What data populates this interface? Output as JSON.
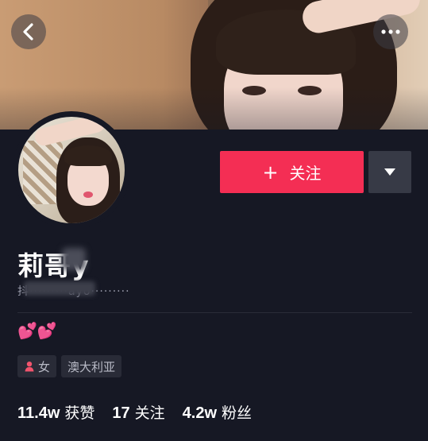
{
  "header": {
    "back_icon": "chevron-left-icon",
    "more_icon": "more-horizontal-icon"
  },
  "actions": {
    "follow_label": "关注",
    "follow_icon": "plus-icon",
    "dropdown_icon": "caret-down-icon",
    "follow_color": "#f42e54"
  },
  "profile": {
    "username": "莉哥y",
    "handle": "抖·········ayo·········",
    "bio_emoji": "💕💕",
    "tags": [
      {
        "icon": "female-icon",
        "label": "女"
      },
      {
        "icon": "",
        "label": "澳大利亚"
      }
    ]
  },
  "stats": [
    {
      "value": "11.4w",
      "label": "获赞"
    },
    {
      "value": "17",
      "label": "关注"
    },
    {
      "value": "4.2w",
      "label": "粉丝"
    }
  ]
}
